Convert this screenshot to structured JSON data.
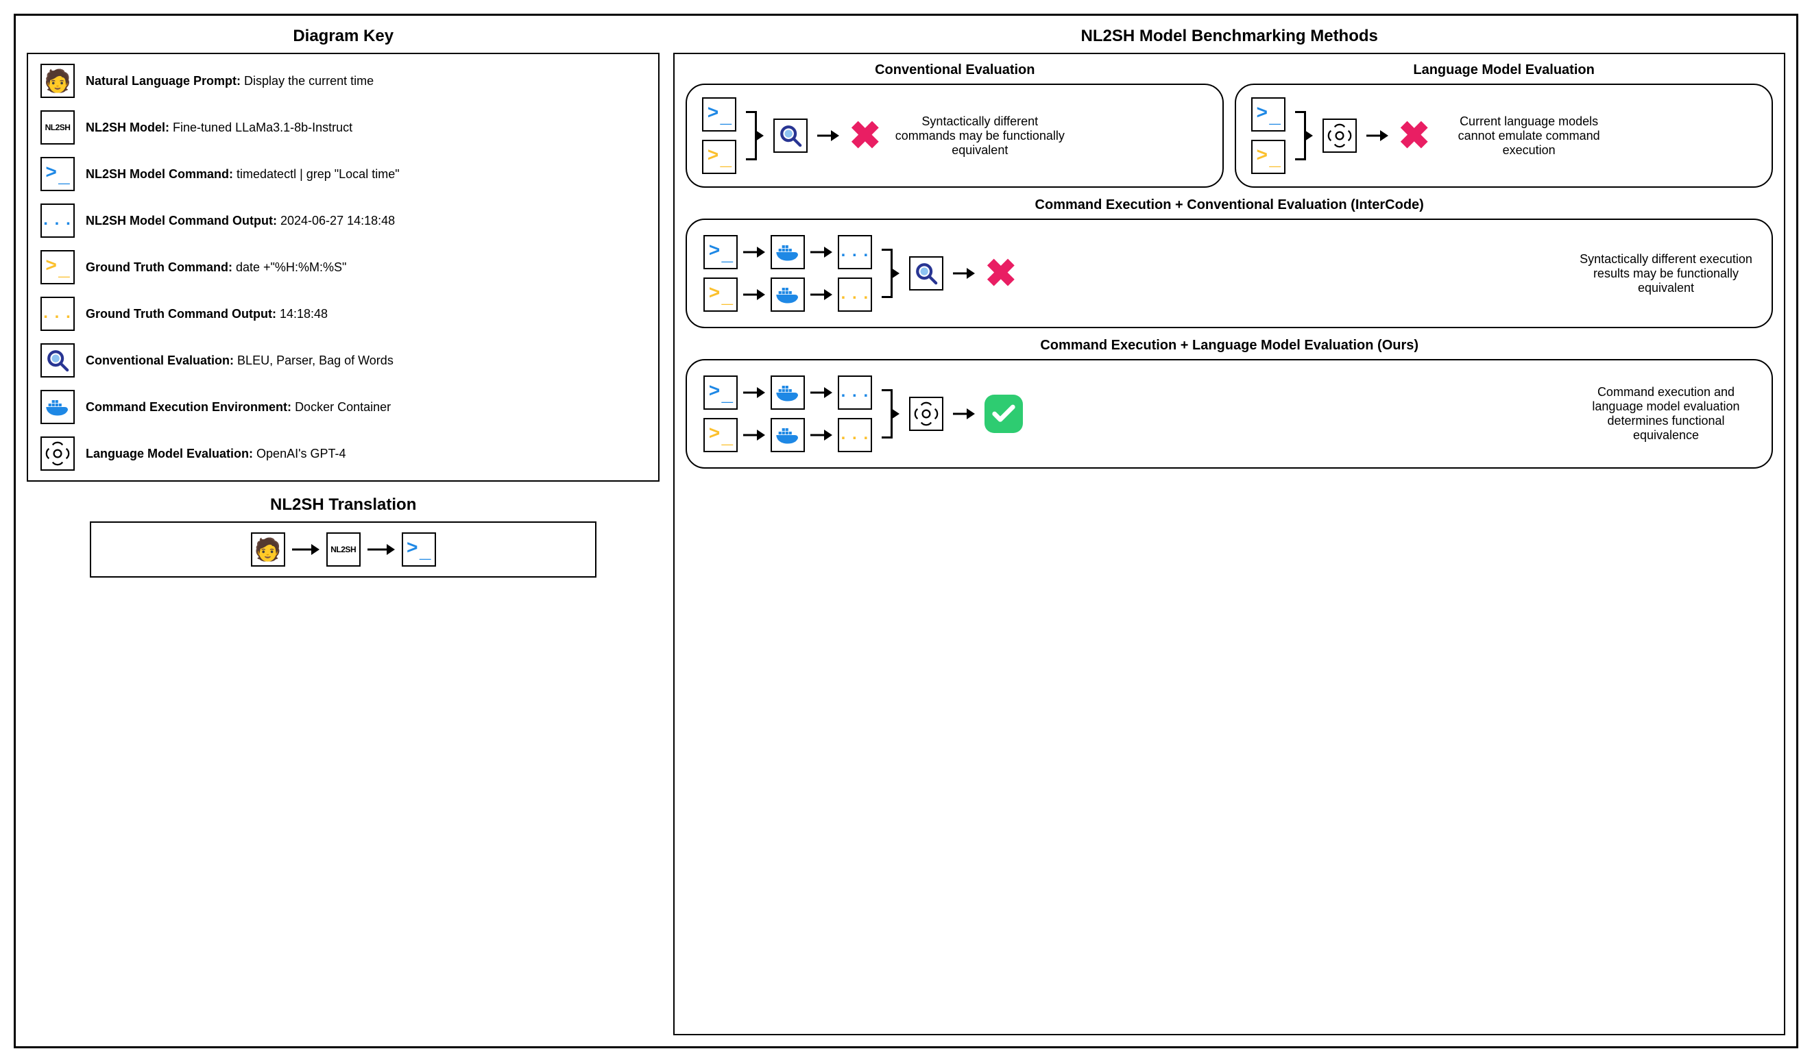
{
  "key": {
    "title": "Diagram Key",
    "items": [
      {
        "label": "Natural Language Prompt:",
        "value": "Display the current time"
      },
      {
        "label": "NL2SH Model:",
        "value": "Fine-tuned LLaMa3.1-8b-Instruct"
      },
      {
        "label": "NL2SH Model Command:",
        "value": "timedatectl | grep \"Local time\""
      },
      {
        "label": "NL2SH Model Command Output:",
        "value": "2024-06-27 14:18:48"
      },
      {
        "label": "Ground Truth Command:",
        "value": "date +\"%H:%M:%S\""
      },
      {
        "label": "Ground Truth Command Output:",
        "value": "14:18:48"
      },
      {
        "label": "Conventional Evaluation:",
        "value": "BLEU, Parser, Bag of Words"
      },
      {
        "label": "Command Execution Environment:",
        "value": "Docker Container"
      },
      {
        "label": "Language Model Evaluation:",
        "value": "OpenAI's GPT-4"
      }
    ]
  },
  "translation": {
    "title": "NL2SH Translation"
  },
  "methods": {
    "title": "NL2SH Model Benchmarking Methods",
    "conventional": {
      "title": "Conventional Evaluation",
      "result": "Syntactically different commands may be functionally equivalent"
    },
    "lm_eval": {
      "title": "Language Model Evaluation",
      "result": "Current language models cannot emulate command execution"
    },
    "exec_conventional": {
      "title": "Command Execution + Conventional Evaluation (InterCode)",
      "result": "Syntactically different execution results may be functionally equivalent"
    },
    "exec_lm": {
      "title": "Command Execution + Language Model Evaluation (Ours)",
      "result": "Command execution and language model evaluation determines functional equivalence"
    }
  },
  "badge": "NL2SH"
}
